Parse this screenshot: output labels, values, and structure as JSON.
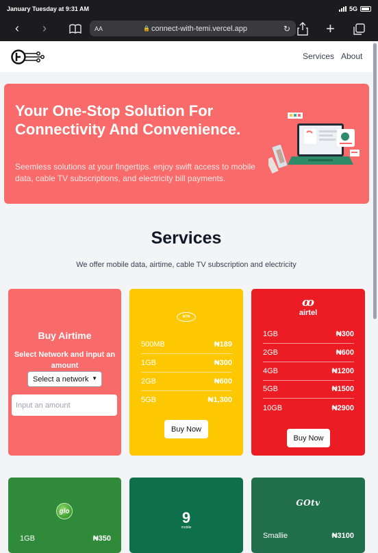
{
  "status_bar": {
    "time": "January Tuesday at 9:31 AM",
    "network": "5G"
  },
  "browser": {
    "text_size_label": "AA",
    "url": "connect-with-temi.vercel.app"
  },
  "nav": {
    "links": [
      "Services",
      "About"
    ]
  },
  "hero": {
    "title": "Your One-Stop Solution For Connectivity And Convenience.",
    "subtitle": "Seemless solutions at your fingertips. enjoy swift access to mobile data, cable TV subscriptions, and electricity bill payments."
  },
  "services": {
    "title": "Services",
    "subtitle": "We offer mobile data, airtime, cable TV subscription and electricity"
  },
  "airtime": {
    "title": "Buy Airtime",
    "description": "Select Network and input an amount",
    "select_value": "Select a network",
    "amount_placeholder": "Input an amount"
  },
  "mtn": {
    "logo_text": "MTN",
    "plans": [
      {
        "size": "500MB",
        "price": "₦189"
      },
      {
        "size": "1GB",
        "price": "₦300"
      },
      {
        "size": "2GB",
        "price": "₦600"
      },
      {
        "size": "5GB",
        "price": "₦1,300"
      }
    ],
    "button": "Buy Now"
  },
  "airtel": {
    "logo_text": "airtel",
    "plans": [
      {
        "size": "1GB",
        "price": "₦300"
      },
      {
        "size": "2GB",
        "price": "₦600"
      },
      {
        "size": "4GB",
        "price": "₦1200"
      },
      {
        "size": "5GB",
        "price": "₦1500"
      },
      {
        "size": "10GB",
        "price": "₦2900"
      }
    ],
    "button": "Buy Now"
  },
  "glo": {
    "logo_text": "glo",
    "plans": [
      {
        "size": "1GB",
        "price": "₦350"
      }
    ]
  },
  "nine_mobile": {
    "logo_number": "9",
    "logo_word": "mobile"
  },
  "gotv": {
    "logo_text": "GOtv",
    "plans": [
      {
        "size": "Smallie",
        "price": "₦3100"
      }
    ]
  },
  "colors": {
    "hero": "#f96b6b",
    "mtn": "#fdc800",
    "airtel": "#ec1c24",
    "glo": "#2f8a3a",
    "nine_mobile": "#0e6f4d",
    "gotv": "#216e4b"
  }
}
